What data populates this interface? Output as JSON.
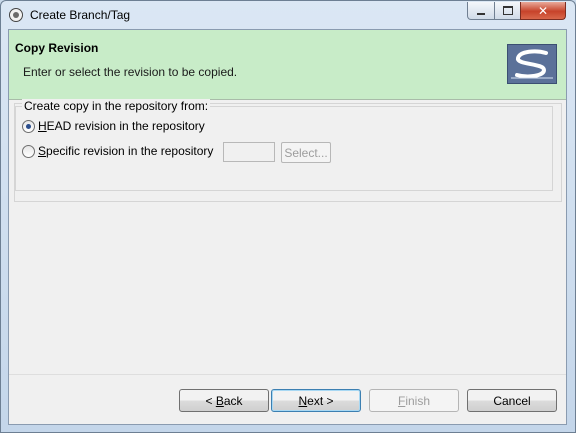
{
  "window": {
    "title": "Create Branch/Tag",
    "minimize_icon": "minimize-icon",
    "maximize_icon": "maximize-icon",
    "close_glyph": "✕"
  },
  "banner": {
    "title": "Copy Revision",
    "description": "Enter or select the revision to be copied.",
    "logo_icon": "svn-logo-icon",
    "background_color": "#c8ecc8"
  },
  "copy_group": {
    "legend": "Create copy in the repository from:",
    "options": [
      {
        "mnemonic": "H",
        "rest": "EAD revision in the repository",
        "selected": true
      },
      {
        "mnemonic": "S",
        "rest": "pecific revision in the repository",
        "selected": false
      }
    ],
    "revision_value": "",
    "select_button": "Select..."
  },
  "buttons": {
    "back_prefix": "< ",
    "back_mnemonic": "B",
    "back_rest": "ack",
    "next_mnemonic": "N",
    "next_rest": "ext >",
    "finish_mnemonic": "F",
    "finish_rest": "inish",
    "cancel": "Cancel"
  }
}
